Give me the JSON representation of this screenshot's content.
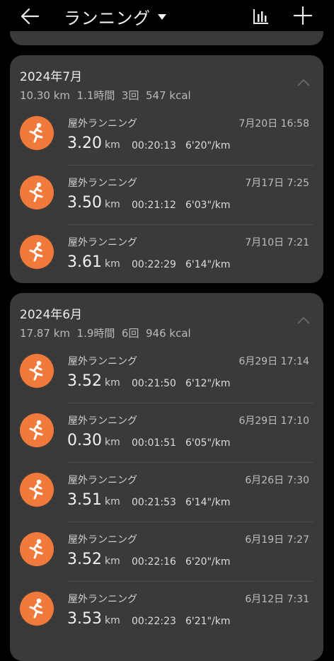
{
  "header": {
    "title": "ランニング"
  },
  "months": [
    {
      "month": "2024年7月",
      "summary": "10.30 km  1.1時間  3回  547 kcal",
      "rows": [
        {
          "type": "屋外ランニング",
          "date": "7月20日 16:58",
          "distance": "3.20",
          "unit": "km",
          "duration": "00:20:13",
          "pace": "6'20\"/km"
        },
        {
          "type": "屋外ランニング",
          "date": "7月17日 7:25",
          "distance": "3.50",
          "unit": "km",
          "duration": "00:21:12",
          "pace": "6'03\"/km"
        },
        {
          "type": "屋外ランニング",
          "date": "7月10日 7:21",
          "distance": "3.61",
          "unit": "km",
          "duration": "00:22:29",
          "pace": "6'14\"/km"
        }
      ]
    },
    {
      "month": "2024年6月",
      "summary": "17.87 km  1.9時間  6回  946 kcal",
      "rows": [
        {
          "type": "屋外ランニング",
          "date": "6月29日 17:14",
          "distance": "3.52",
          "unit": "km",
          "duration": "00:21:50",
          "pace": "6'12\"/km"
        },
        {
          "type": "屋外ランニング",
          "date": "6月29日 17:10",
          "distance": "0.30",
          "unit": "km",
          "duration": "00:01:51",
          "pace": "6'05\"/km"
        },
        {
          "type": "屋外ランニング",
          "date": "6月26日 7:30",
          "distance": "3.51",
          "unit": "km",
          "duration": "00:21:53",
          "pace": "6'14\"/km"
        },
        {
          "type": "屋外ランニング",
          "date": "6月19日 7:27",
          "distance": "3.52",
          "unit": "km",
          "duration": "00:22:16",
          "pace": "6'20\"/km"
        },
        {
          "type": "屋外ランニング",
          "date": "6月12日 7:31",
          "distance": "3.53",
          "unit": "km",
          "duration": "00:22:23",
          "pace": "6'21\"/km"
        }
      ]
    }
  ],
  "icons": {
    "back": "arrow-left-icon",
    "dropdown": "caret-down-icon",
    "stats": "bar-chart-icon",
    "add": "plus-icon",
    "collapse": "chevron-up-icon",
    "activity": "running-person-icon"
  },
  "colors": {
    "background": "#000000",
    "card": "#3a3a3a",
    "accent": "#f07a3c"
  }
}
